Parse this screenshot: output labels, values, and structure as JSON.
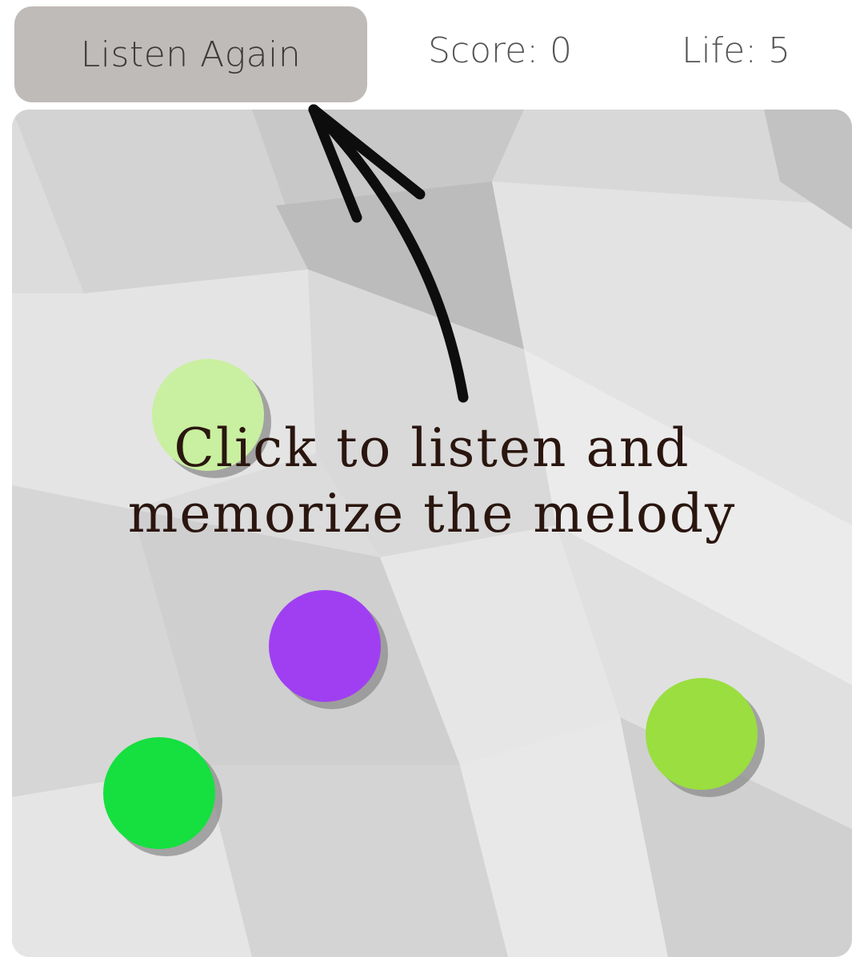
{
  "header": {
    "listen_button_label": "Listen Again",
    "score_text": "Score: 0",
    "life_text": "Life: 5"
  },
  "board": {
    "instruction_line1": "Click to listen and",
    "instruction_line2": "memorize the melody",
    "pads": [
      {
        "name": "pad-light-green",
        "color": "#c9efa0"
      },
      {
        "name": "pad-purple",
        "color": "#a03ff2"
      },
      {
        "name": "pad-lime",
        "color": "#9ade40"
      },
      {
        "name": "pad-green",
        "color": "#15e03f"
      }
    ]
  },
  "colors": {
    "button_bg": "#bfbbb8",
    "text_dark": "#2a160f",
    "arrow": "#0d0d0d"
  },
  "icons": {
    "hint_arrow": "arrow-up-left-icon"
  }
}
